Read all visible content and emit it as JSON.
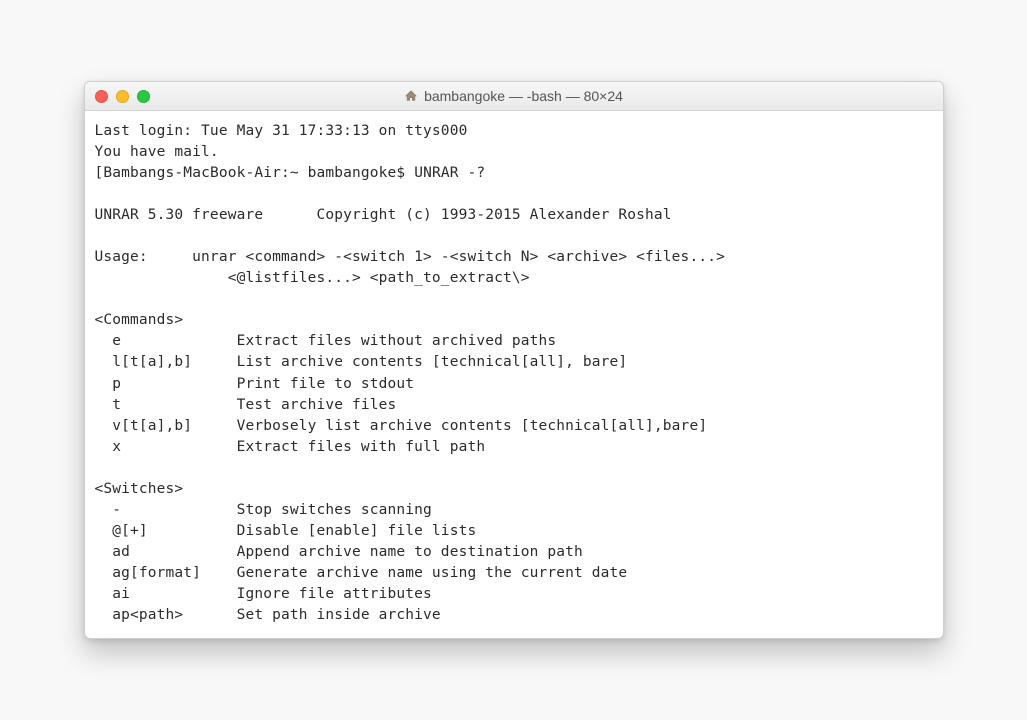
{
  "titlebar": {
    "title": "bambangoke — -bash — 80×24"
  },
  "terminal": {
    "line01": "Last login: Tue May 31 17:33:13 on ttys000",
    "line02": "You have mail.",
    "line03_prefix": "[",
    "line03_prompt": "Bambangs-MacBook-Air:~ bambangoke$",
    "line03_cmd": "UNRAR -?",
    "line04": "",
    "line05": "UNRAR 5.30 freeware      Copyright (c) 1993-2015 Alexander Roshal",
    "line06": "",
    "line07": "Usage:     unrar <command> -<switch 1> -<switch N> <archive> <files...>",
    "line08": "               <@listfiles...> <path_to_extract\\>",
    "line09": "",
    "line10": "<Commands>",
    "line11": "  e             Extract files without archived paths",
    "line12": "  l[t[a],b]     List archive contents [technical[all], bare]",
    "line13": "  p             Print file to stdout",
    "line14": "  t             Test archive files",
    "line15": "  v[t[a],b]     Verbosely list archive contents [technical[all],bare]",
    "line16": "  x             Extract files with full path",
    "line17": "",
    "line18": "<Switches>",
    "line19": "  -             Stop switches scanning",
    "line20": "  @[+]          Disable [enable] file lists",
    "line21": "  ad            Append archive name to destination path",
    "line22": "  ag[format]    Generate archive name using the current date",
    "line23": "  ai            Ignore file attributes",
    "line24": "  ap<path>      Set path inside archive"
  }
}
